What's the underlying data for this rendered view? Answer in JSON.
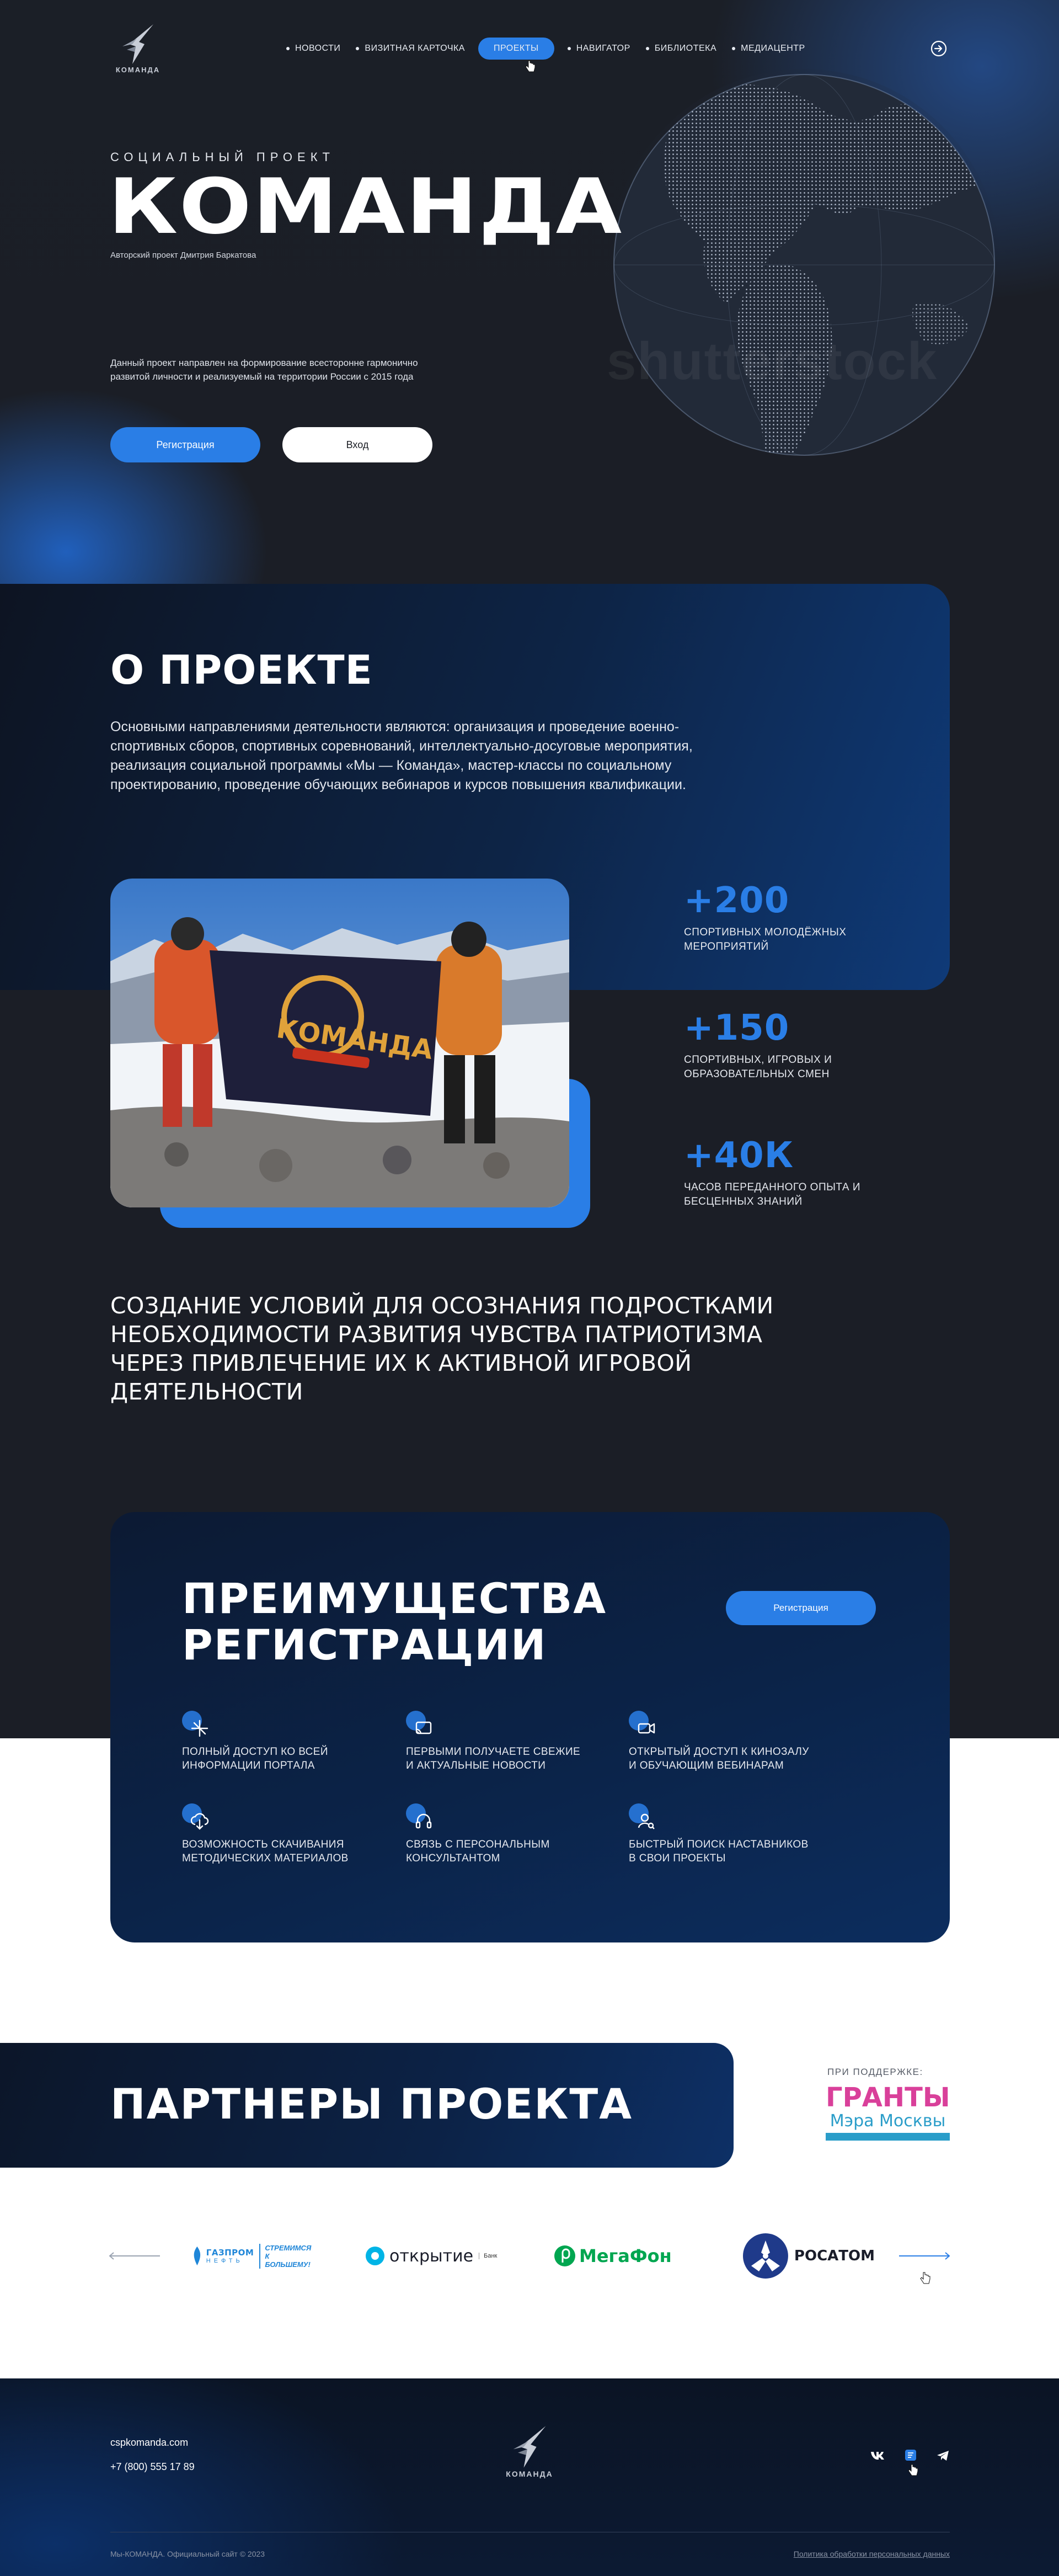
{
  "header": {
    "logo_text": "КОМАНДА",
    "nav": [
      {
        "label": "НОВОСТИ",
        "active": false
      },
      {
        "label": "ВИЗИТНАЯ КАРТОЧКА",
        "active": false
      },
      {
        "label": "ПРОЕКТЫ",
        "active": true
      },
      {
        "label": "НАВИГАТОР",
        "active": false
      },
      {
        "label": "БИБЛИОТЕКА",
        "active": false
      },
      {
        "label": "МЕДИАЦЕНТР",
        "active": false
      }
    ],
    "login_icon": "login-icon"
  },
  "hero": {
    "eyebrow": "СОЦИАЛЬНЫЙ ПРОЕКТ",
    "title": "КОМАНДА",
    "subtitle": "Авторский проект Дмитрия Баркатова",
    "description": "Данный проект направлен на формирование всесторонне гармонично развитой личности и реализуемый на территории России с 2015 года",
    "register_label": "Регистрация",
    "login_label": "Вход",
    "watermark": "shutterstock"
  },
  "about": {
    "title": "О ПРОЕКТЕ",
    "text": "Основными направлениями деятельности являются: организация и проведение военно-спортивных сборов, спортивных соревнований, интеллектуально-досуговые мероприятия, реализация социальной программы «Мы — Команда», мастер-классы по социальному проектированию, проведение обучающих вебинаров и курсов повышения квалификации.",
    "photo_flag_text": "КОМАНДА",
    "stats": [
      {
        "value": "+200",
        "label": "СПОРТИВНЫХ МОЛОДЁЖНЫХ МЕРОПРИЯТИЙ"
      },
      {
        "value": "+150",
        "label": "СПОРТИВНЫХ, ИГРОВЫХ И ОБРАЗОВАТЕЛЬНЫХ СМЕН"
      },
      {
        "value": "+40К",
        "label": "ЧАСОВ ПЕРЕДАННОГО ОПЫТА И БЕСЦЕННЫХ ЗНАНИЙ"
      }
    ],
    "mission": "СОЗДАНИЕ УСЛОВИЙ ДЛЯ ОСОЗНАНИЯ ПОДРОСТКАМИ НЕОБХОДИМОСТИ РАЗВИТИЯ ЧУВСТВА ПАТРИОТИЗМА ЧЕРЕЗ ПРИВЛЕЧЕНИЕ ИХ К АКТИВНОЙ ИГРОВОЙ ДЕЯТЕЛЬНОСТИ"
  },
  "advantages": {
    "title_line1": "ПРЕИМУЩЕСТВА",
    "title_line2": "РЕГИСТРАЦИИ",
    "register_label": "Регистрация",
    "items": [
      {
        "icon": "access-icon",
        "line1": "ПОЛНЫЙ ДОСТУП КО ВСЕЙ",
        "line2": "ИНФОРМАЦИИ ПОРТАЛА"
      },
      {
        "icon": "news-cast-icon",
        "line1": "ПЕРВЫМИ ПОЛУЧАЕТЕ СВЕЖИЕ",
        "line2": "И АКТУАЛЬНЫЕ НОВОСТИ"
      },
      {
        "icon": "video-camera-icon",
        "line1": "ОТКРЫТЫЙ ДОСТУП К КИНОЗАЛУ",
        "line2": "И ОБУЧАЮЩИМ ВЕБИНАРАМ"
      },
      {
        "icon": "cloud-download-icon",
        "line1": "ВОЗМОЖНОСТЬ СКАЧИВАНИЯ",
        "line2": "МЕТОДИЧЕСКИХ МАТЕРИАЛОВ"
      },
      {
        "icon": "headset-icon",
        "line1": "СВЯЗЬ С ПЕРСОНАЛЬНЫМ",
        "line2": "КОНСУЛЬТАНТОМ"
      },
      {
        "icon": "user-search-icon",
        "line1": "БЫСТРЫЙ ПОИСК НАСТАВНИКОВ",
        "line2": "В СВОИ ПРОЕКТЫ"
      }
    ]
  },
  "partners": {
    "title": "ПАРТНЕРЫ ПРОЕКТА",
    "support_label": "ПРИ ПОДДЕРЖКЕ:",
    "grants_line1": "ГРАНТЫ",
    "grants_line2": "Мэра Москвы",
    "logos": [
      {
        "name": "ГАЗПРОМ",
        "sub": "НЕФТЬ",
        "tagline1": "СТРЕМИМСЯ",
        "tagline2": "К БОЛЬШЕМУ!"
      },
      {
        "name": "открытие",
        "sub": "Банк"
      },
      {
        "name": "МегаФон"
      },
      {
        "name": "РОСАТОМ"
      }
    ]
  },
  "footer": {
    "site": "cspkomanda.com",
    "phone": "+7 (800) 555 17 89",
    "logo_text": "КОМАНДА",
    "copyright": "Мы-КОМАНДА. Официальный сайт © 2023",
    "privacy": "Политика обработки персональных данных",
    "social": [
      "vk-icon",
      "message-icon",
      "telegram-icon"
    ]
  },
  "colors": {
    "accent": "#2a7ee6",
    "dark": "#1b1e26",
    "navy": "#0c2246"
  }
}
